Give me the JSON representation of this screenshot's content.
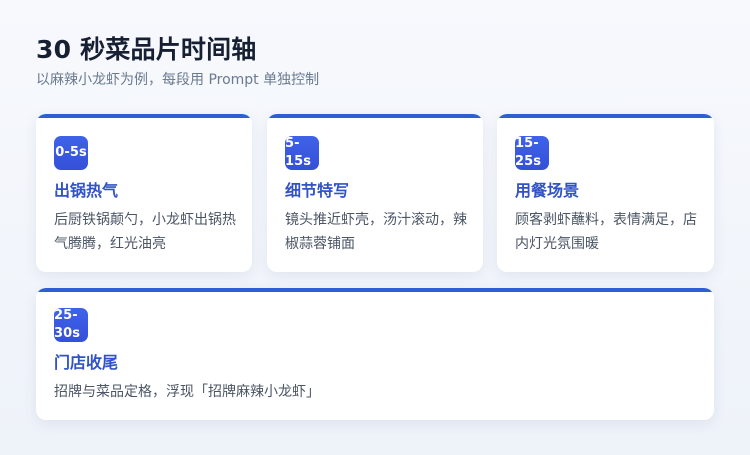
{
  "header": {
    "title": "30 秒菜品片时间轴",
    "subtitle": "以麻辣小龙虾为例，每段用 Prompt 单独控制"
  },
  "cards": [
    {
      "time_label": "0-5s",
      "title": "出锅热气",
      "description": "后厨铁锅颠勺，小龙虾出锅热气腾腾，红光油亮"
    },
    {
      "time_label": "5-\n15s",
      "title": "细节特写",
      "description": "镜头推近虾壳，汤汁滚动，辣椒蒜蓉铺面"
    },
    {
      "time_label": "15-\n25s",
      "title": "用餐场景",
      "description": "顾客剥虾蘸料，表情满足，店内灯光氛围暖"
    },
    {
      "time_label": "25-\n30s",
      "title": "门店收尾",
      "description": "招牌与菜品定格，浮现「招牌麻辣小龙虾」"
    }
  ],
  "colors": {
    "accent": "#2d5fd3",
    "badge": "#3f63e8",
    "title": "#3253c7"
  }
}
